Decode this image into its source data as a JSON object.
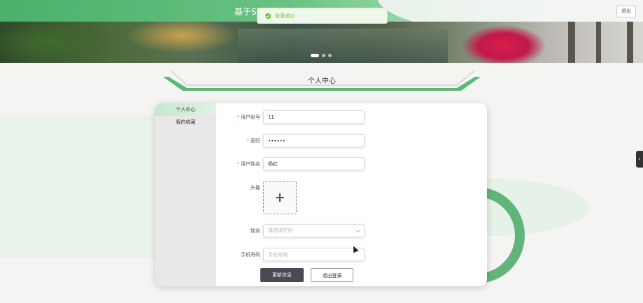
{
  "header": {
    "site_title": "基于Sp",
    "logout_label": "退出"
  },
  "toast": {
    "message": "登录成功"
  },
  "carousel": {
    "slides": 3,
    "active_index": 0
  },
  "page": {
    "title": "个人中心"
  },
  "sidebar": {
    "items": [
      {
        "label": "个人中心",
        "active": true
      },
      {
        "label": "我的收藏",
        "active": false
      }
    ]
  },
  "form": {
    "account": {
      "label": "用户账号",
      "value": "11",
      "required": true
    },
    "password": {
      "label": "密码",
      "value": "••••••",
      "required": true
    },
    "name": {
      "label": "用户姓名",
      "value": "杨红",
      "required": true
    },
    "avatar": {
      "label": "头像"
    },
    "gender": {
      "label": "性别",
      "placeholder": "请选择性别"
    },
    "phone": {
      "label": "手机号码",
      "placeholder": "手机号码"
    }
  },
  "buttons": {
    "update_label": "更新信息",
    "logout_label": "退出登录"
  },
  "colors": {
    "accent": "#62b57a",
    "button_dark": "#4a4a55",
    "success": "#67c23a"
  }
}
